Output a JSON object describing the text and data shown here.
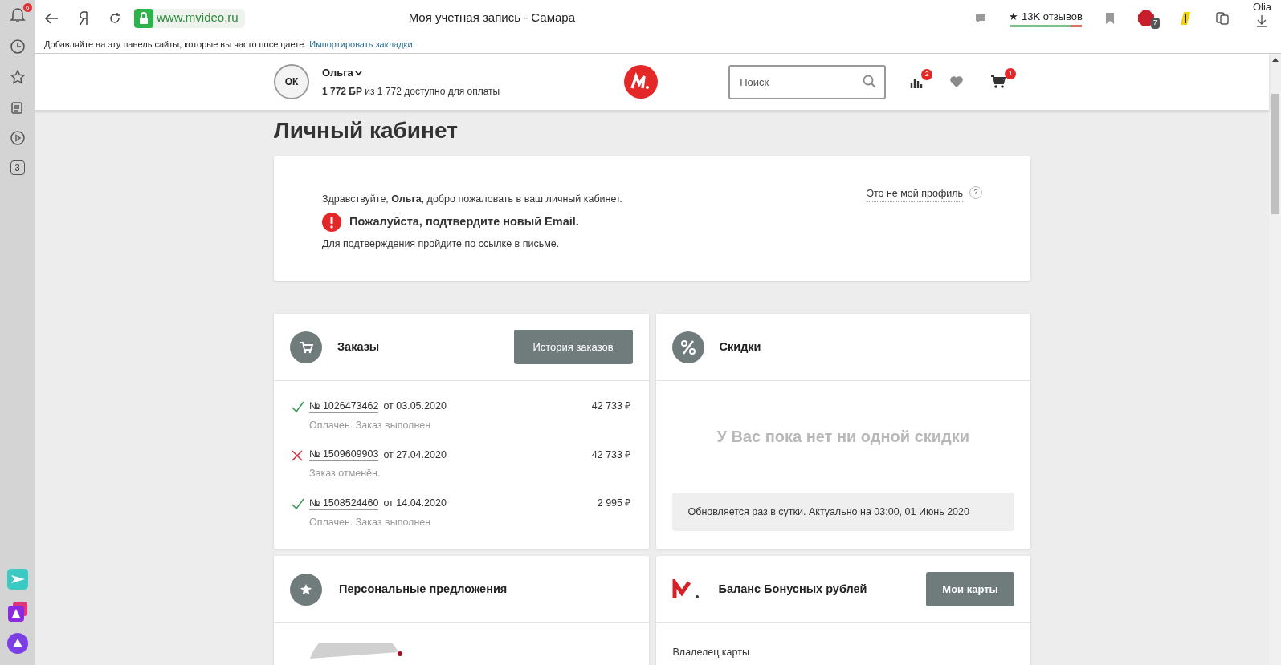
{
  "browser": {
    "notifications_badge": "6",
    "url": "www.mvideo.ru",
    "tab_title": "Моя учетная запись - Самара",
    "reviews": "★ 13K отзывов",
    "adblock_badge": "7",
    "profile": "Olia",
    "bookmarks_hint": "Добавляйте на эту панель сайты, которые вы часто посещаете.",
    "import_link": "Импортировать закладки",
    "sidebar_counter": "3"
  },
  "header": {
    "avatar": "ОК",
    "user_name": "Ольга",
    "balance": "**1 772 БР** из 1 772 доступно для оплаты",
    "search": {
      "placeholder": "Поиск"
    },
    "compare_badge": "2",
    "cart_badge": "1"
  },
  "page_title": "Личный кабинет",
  "welcome": {
    "greeting": "Здравствуйте, **Ольга**, добро пожаловать в ваш личный кабинет.",
    "not_my_profile": "Это не мой профиль",
    "help": "?",
    "alert": "Пожалуйста, подтвердите новый Email.",
    "note": "Для подтверждения пройдите по ссылке в письме."
  },
  "orders": {
    "title": "Заказы",
    "button": "История заказов",
    "items": [
      {
        "kind": "completed",
        "number": "№ 1026473462",
        "date": "от 03.05.2020",
        "price": "42 733 ₽",
        "state": "Оплачен. Заказ выполнен"
      },
      {
        "kind": "cancelled",
        "number": "№ 1509609903",
        "date": "от 27.04.2020",
        "price": "42 733 ₽",
        "state": "Заказ отменён."
      },
      {
        "kind": "completed",
        "number": "№ 1508524460",
        "date": "от 14.04.2020",
        "price": "2 995 ₽",
        "state": "Оплачен. Заказ выполнен"
      }
    ]
  },
  "discounts": {
    "title": "Скидки",
    "empty": "У Вас пока нет ни одной скидки",
    "updated": "Обновляется раз в сутки. Актуально на 03:00, 01 Июнь 2020"
  },
  "offers": {
    "title": "Персональные предложения"
  },
  "bonus": {
    "title": "Баланс Бонусных рублей",
    "button": "Мои карты",
    "owner_label": "Владелец карты"
  }
}
